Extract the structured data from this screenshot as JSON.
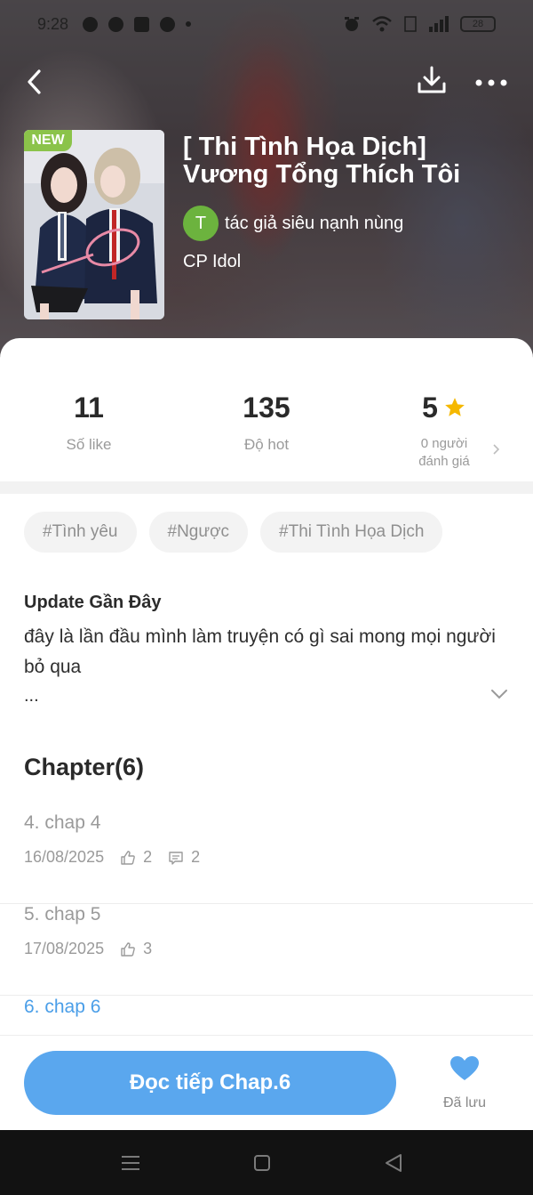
{
  "status_bar": {
    "time": "9:28",
    "battery": "28"
  },
  "book": {
    "badge": "NEW",
    "title": "[ Thi Tình Họa Dịch] Vương Tổng Thích Tôi",
    "author_initial": "T",
    "author": "tác giả siêu nạnh nùng",
    "category": "CP Idol"
  },
  "stats": {
    "likes": {
      "value": "11",
      "label": "Số like"
    },
    "hot": {
      "value": "135",
      "label": "Độ hot"
    },
    "rating": {
      "value": "5",
      "label_line1": "0 người",
      "label_line2": "đánh giá"
    }
  },
  "tags": [
    "#Tình yêu",
    "#Ngược",
    "#Thi Tình Họa Dịch"
  ],
  "update": {
    "title": "Update Gần Đây",
    "text": "đây là lần đầu mình làm truyện có gì sai mong mọi người bỏ qua",
    "ellipsis": "..."
  },
  "chapters": {
    "heading": "Chapter(6)",
    "items": [
      {
        "title": "4. chap 4",
        "date": "16/08/2025",
        "likes": "2",
        "comments": "2"
      },
      {
        "title": "5. chap 5",
        "date": "17/08/2025",
        "likes": "3"
      },
      {
        "title": "6. chap 6"
      }
    ]
  },
  "actions": {
    "read_label": "Đọc tiếp Chap.6",
    "saved_label": "Đã lưu"
  },
  "colors": {
    "accent": "#5aa7ee",
    "badge": "#8bc34a",
    "avatar": "#6cb33e",
    "star": "#f5b800",
    "active_chapter": "#4a9ee8"
  }
}
